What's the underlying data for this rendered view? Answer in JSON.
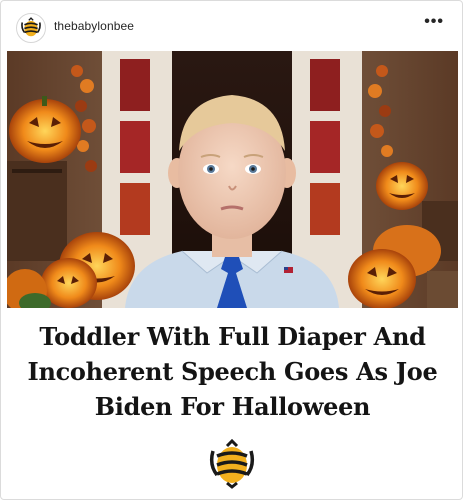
{
  "post": {
    "username": "thebabylonbee",
    "more_label": "•••",
    "headline": "Toddler With Full Diaper And Incoherent Speech Goes As Joe Biden For Halloween"
  },
  "icons": {
    "avatar": "babylon-bee-logo-icon",
    "more": "more-options-icon",
    "brand": "babylon-bee-logo-icon"
  },
  "colors": {
    "bee_yellow": "#f2b01e",
    "bee_dark": "#1a1a1a",
    "tie_blue": "#1f4fb8",
    "shirt_blue": "#c9d9ea"
  }
}
